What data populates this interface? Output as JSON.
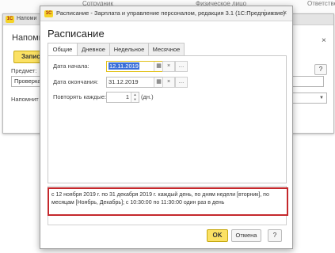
{
  "background": {
    "top_columns": [
      "Сотрудник",
      "Физическое лицо",
      "Ответствен"
    ],
    "window_title": "Напоми",
    "heading": "Напоми",
    "save_button": "Записа",
    "fields": [
      {
        "label": "Предмет:",
        "value": "Проверка"
      },
      {
        "label": "Напомнит",
        "value": ""
      }
    ],
    "help_button": "?",
    "close_icon": "×",
    "logo": "1С"
  },
  "dialog": {
    "title": "Расписание - Зарплата и управление персоналом, редакция 3.1  (1С:Предприятие)",
    "logo": "1С",
    "controls": {
      "menu": "⋮",
      "minimize": "▭",
      "close": "×"
    },
    "heading": "Расписание",
    "tabs": [
      "Общие",
      "Дневное",
      "Недельное",
      "Месячное"
    ],
    "active_tab": 0,
    "start_date": {
      "label": "Дата начала:",
      "value": "12.11.2019"
    },
    "end_date": {
      "label": "Дата окончания:",
      "value": "31.12.2019"
    },
    "repeat": {
      "label": "Повторять каждые:",
      "value": "1",
      "unit": "(дн.)"
    },
    "summary": "с 12 ноября 2019 г. по 31 декабря 2019 г. каждый день, по дням недели [вторник], по месяцам [Ноябрь, Декабрь]; с 10:30:00 по 11:30:00 один раз в день",
    "buttons": {
      "ok": "OK",
      "cancel": "Отмена",
      "help": "?"
    }
  },
  "colors": {
    "accent": "#fbe164",
    "highlight": "#c4282c",
    "selection": "#3a6fd8"
  }
}
